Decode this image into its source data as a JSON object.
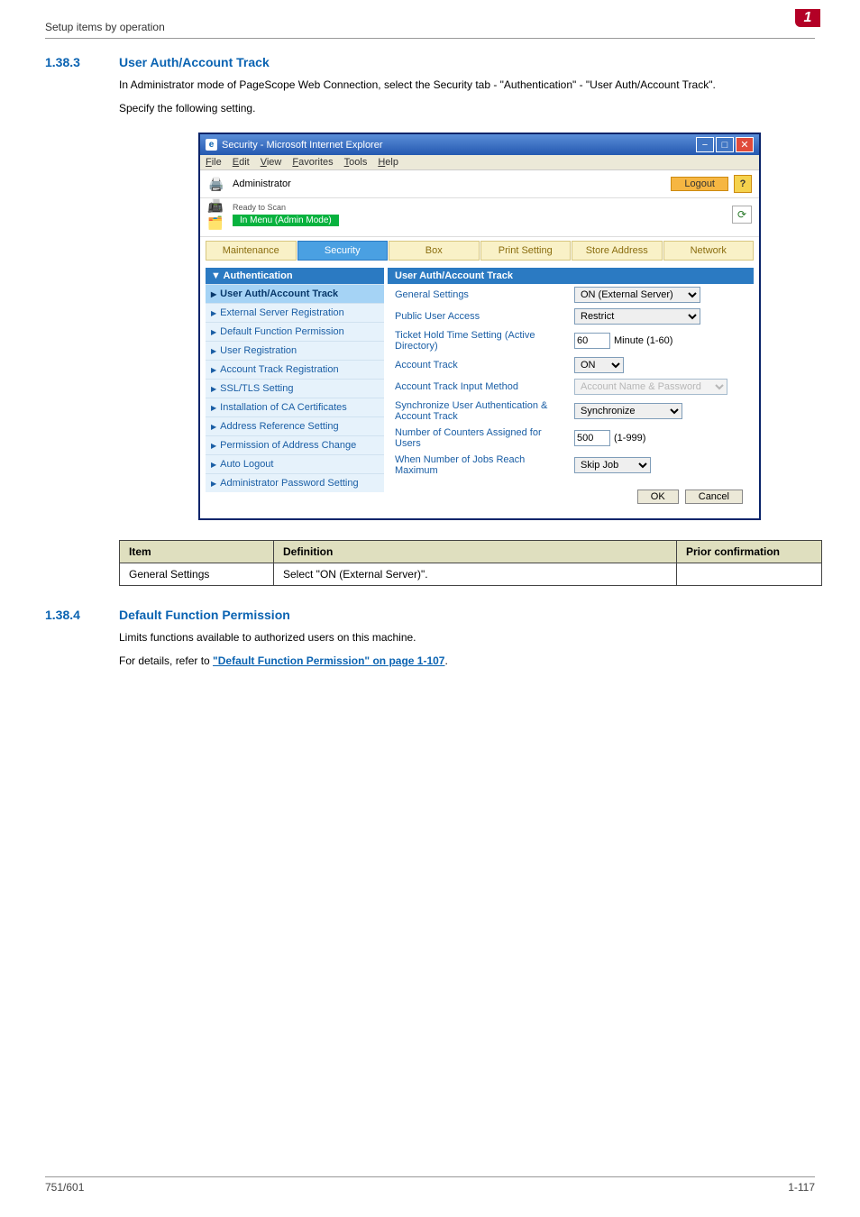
{
  "header": {
    "breadcrumb": "Setup items by operation",
    "page_badge": "1"
  },
  "sec1": {
    "num": "1.38.3",
    "title": "User Auth/Account Track",
    "para1": "In Administrator mode of PageScope Web Connection, select the Security tab - \"Authentication\" - \"User Auth/Account Track\".",
    "para2": "Specify the following setting."
  },
  "ie": {
    "title": "Security - Microsoft Internet Explorer",
    "menu": {
      "file": "File",
      "edit": "Edit",
      "view": "View",
      "favorites": "Favorites",
      "tools": "Tools",
      "help": "Help"
    },
    "adminlabel": "Administrator",
    "logout": "Logout",
    "ready": "Ready to Scan",
    "adminmode": "In Menu (Admin Mode)"
  },
  "tabs": {
    "maintenance": "Maintenance",
    "security": "Security",
    "box": "Box",
    "print": "Print Setting",
    "store": "Store Address",
    "network": "Network"
  },
  "sidebar": {
    "head": "Authentication",
    "items": [
      "User Auth/Account Track",
      "External Server Registration",
      "Default Function Permission",
      "User Registration",
      "Account Track Registration",
      "SSL/TLS Setting",
      "Installation of CA Certificates",
      "Address Reference Setting",
      "Permission of Address Change",
      "Auto Logout",
      "Administrator Password Setting"
    ]
  },
  "panel": {
    "head": "User Auth/Account Track",
    "rows": {
      "general": "General Settings",
      "generalv": "ON (External Server)",
      "pua": "Public User Access",
      "puav": "Restrict",
      "ticket": "Ticket Hold Time Setting (Active Directory)",
      "ticket_val": "60",
      "ticket_unit": "Minute (1-60)",
      "at": "Account Track",
      "atv": "ON",
      "atim": "Account Track Input Method",
      "atimv": "Account Name & Password",
      "sync": "Synchronize User Authentication & Account Track",
      "syncv": "Synchronize",
      "counters": "Number of Counters Assigned for Users",
      "counters_val": "500",
      "counters_unit": "(1-999)",
      "jobs": "When Number of Jobs Reach Maximum",
      "jobsv": "Skip Job"
    },
    "ok": "OK",
    "cancel": "Cancel"
  },
  "doctable": {
    "h_item": "Item",
    "h_def": "Definition",
    "h_prior": "Prior confirmation",
    "r1_item": "General Settings",
    "r1_def": "Select \"ON (External Server)\"."
  },
  "sec2": {
    "num": "1.38.4",
    "title": "Default Function Permission",
    "para1": "Limits functions available to authorized users on this machine.",
    "para2a": "For details, refer to ",
    "para2link": "\"Default Function Permission\" on page 1-107",
    "para2b": "."
  },
  "footer": {
    "left": "751/601",
    "right": "1-117"
  }
}
